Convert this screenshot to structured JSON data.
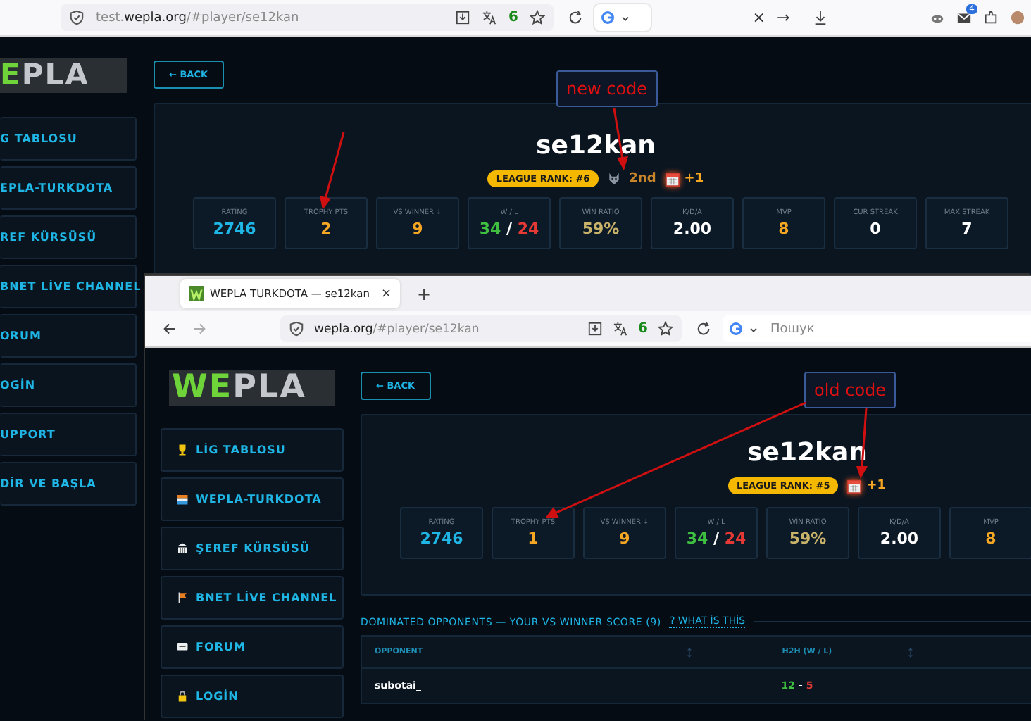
{
  "back_window": {
    "address_bar": {
      "url_host": "test.",
      "url_domain": "wepla.org",
      "url_path": "/#player/se12kan",
      "extension_count": "6",
      "badge_count": "4",
      "close_glyph": "×",
      "go_glyph": "→"
    },
    "logo": {
      "accent": "E",
      "rest": "PLA"
    },
    "sidebar": {
      "items": [
        {
          "label": "G TABLOSU"
        },
        {
          "label": "EPLA-TURKDOTA"
        },
        {
          "label": "REF KÜRSÜSÜ"
        },
        {
          "label": "BNET LİVE CHANNEL"
        },
        {
          "label": "ORUM"
        },
        {
          "label": "OGİN"
        },
        {
          "label": "UPPORT"
        },
        {
          "label": "DİR VE BAŞLA"
        }
      ]
    },
    "back_button": "← BACK",
    "player": {
      "name": "se12kan",
      "league_rank": "LEAGUE RANK: #6",
      "place": "2nd",
      "streak_bonus": "+1"
    },
    "stats": [
      {
        "kind": "single",
        "label": "RATİNG",
        "value": "2746",
        "color": "#1fb6e6"
      },
      {
        "kind": "single",
        "label": "TROPHY PTS",
        "value": "2",
        "color": "#f5a623"
      },
      {
        "kind": "single",
        "label": "VS WİNNER ↓",
        "value": "9",
        "color": "#f5a623"
      },
      {
        "kind": "ratio",
        "label": "W / L",
        "wins": "34",
        "separator": "/",
        "losses": "24"
      },
      {
        "kind": "single",
        "label": "WİN RATİO",
        "value": "59%",
        "color": "#c9b36a"
      },
      {
        "kind": "single",
        "label": "K/D/A",
        "value": "2.00",
        "color": "#ffffff"
      },
      {
        "kind": "single",
        "label": "MVP",
        "value": "8",
        "color": "#f5a623"
      },
      {
        "kind": "single",
        "label": "CUR STREAK",
        "value": "0",
        "color": "#ffffff"
      },
      {
        "kind": "single",
        "label": "MAX STREAK",
        "value": "7",
        "color": "#ffffff"
      }
    ],
    "annotation": "new code"
  },
  "front_window": {
    "tab": {
      "title": "WEPLA TURKDOTA — se12kan",
      "close_glyph": "×",
      "new_tab_glyph": "+"
    },
    "address_bar": {
      "url_domain": "wepla.org",
      "url_path": "/#player/se12kan",
      "extension_count": "6",
      "search_placeholder": "Пошук"
    },
    "logo": {
      "accent": "WE",
      "rest": "PLA"
    },
    "sidebar": {
      "items": [
        {
          "label": "LİG TABLOSU"
        },
        {
          "label": "WEPLA-TURKDOTA"
        },
        {
          "label": "ŞEREF KÜRSÜSÜ"
        },
        {
          "label": "BNET LİVE CHANNEL"
        },
        {
          "label": "FORUM"
        },
        {
          "label": "LOGİN"
        }
      ]
    },
    "back_button": "← BACK",
    "player": {
      "name": "se12kan",
      "league_rank": "LEAGUE RANK: #5",
      "streak_bonus": "+1"
    },
    "stats": [
      {
        "kind": "single",
        "label": "RATİNG",
        "value": "2746",
        "color": "#1fb6e6"
      },
      {
        "kind": "single",
        "label": "TROPHY PTS",
        "value": "1",
        "color": "#f5a623"
      },
      {
        "kind": "single",
        "label": "VS WİNNER ↓",
        "value": "9",
        "color": "#f5a623"
      },
      {
        "kind": "ratio",
        "label": "W / L",
        "wins": "34",
        "separator": "/",
        "losses": "24"
      },
      {
        "kind": "single",
        "label": "WİN RATİO",
        "value": "59%",
        "color": "#c9b36a"
      },
      {
        "kind": "single",
        "label": "K/D/A",
        "value": "2.00",
        "color": "#ffffff"
      },
      {
        "kind": "single",
        "label": "MVP",
        "value": "8",
        "color": "#f5a623"
      }
    ],
    "section": {
      "heading": "DOMINATED OPPONENTS — YOUR VS WINNER SCORE (9)",
      "help_link": "? WHAT İS THİS"
    },
    "table": {
      "columns": [
        "OPPONENT",
        "H2H (W / L)"
      ],
      "rows": [
        {
          "opponent": "subotai_",
          "wins": "12",
          "separator": "-",
          "losses": "5"
        }
      ]
    },
    "annotation": "old code"
  }
}
